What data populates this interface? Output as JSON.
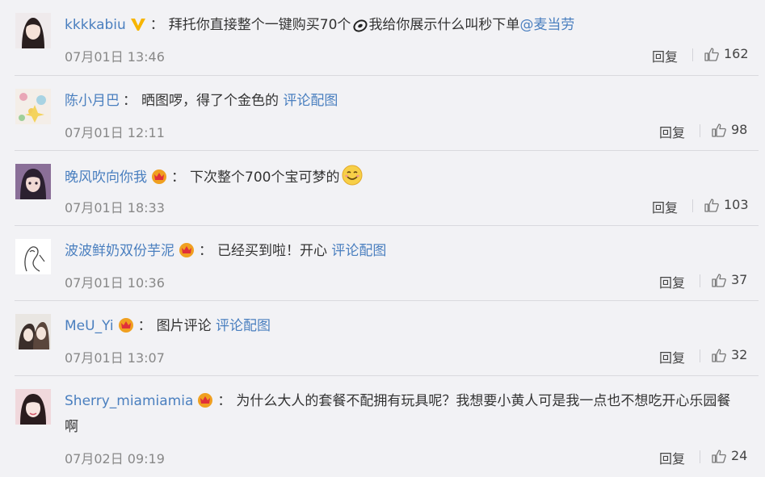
{
  "comments": [
    {
      "username": "kkkkabiu",
      "badge": "v-verified",
      "text": "拜托你直接整个一键购买70个",
      "emoji": "hands-together",
      "text2": "我给你展示什么叫秒下单",
      "mention": "@麦当劳",
      "time": "07月01日 13:46",
      "reply": "回复",
      "likes": "162"
    },
    {
      "username": "陈小月巴",
      "text": "晒图啰，得了个金色的",
      "link": "评论配图",
      "time": "07月01日 12:11",
      "reply": "回复",
      "likes": "98"
    },
    {
      "username": "晚风吹向你我",
      "badge": "crown",
      "text": "下次整个700个宝可梦的",
      "emoji": "smile",
      "time": "07月01日 18:33",
      "reply": "回复",
      "likes": "103"
    },
    {
      "username": "波波鲜奶双份芋泥",
      "badge": "crown",
      "text": "已经买到啦！开心",
      "link": "评论配图",
      "time": "07月01日 10:36",
      "reply": "回复",
      "likes": "37"
    },
    {
      "username": "MeU_Yi",
      "badge": "crown",
      "text": "图片评论",
      "link": "评论配图",
      "time": "07月01日 13:07",
      "reply": "回复",
      "likes": "32"
    },
    {
      "username": "Sherry_miamiamia",
      "badge": "crown",
      "text": "为什么大人的套餐不配拥有玩具呢？我想要小黄人可是我一点也不想吃开心乐园餐",
      "text_line2": "啊",
      "time": "07月02日 09:19",
      "reply": "回复",
      "likes": "24"
    }
  ],
  "colors": {
    "background": "#f2f2f5",
    "username": "#4a7fbf",
    "link": "#4a7fbf",
    "time": "#888888",
    "crown": "#f0a020",
    "verified": "#f7b500"
  }
}
